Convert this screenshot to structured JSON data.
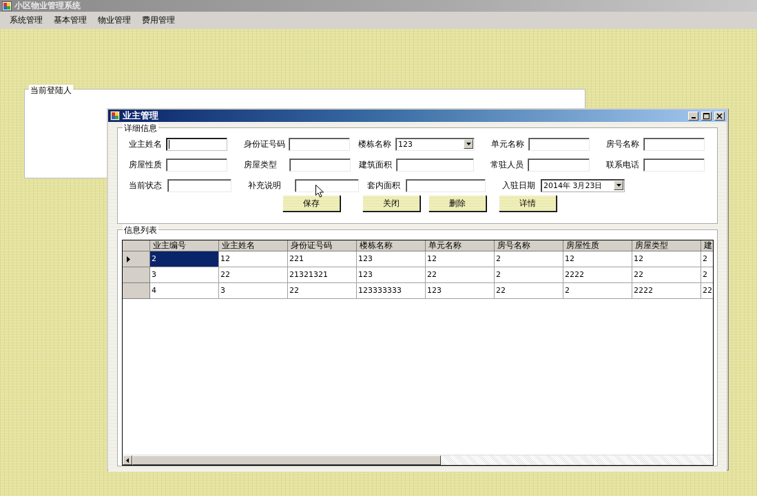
{
  "window": {
    "title": "小区物业管理系统"
  },
  "menu": [
    "系统管理",
    "基本管理",
    "物业管理",
    "费用管理"
  ],
  "login_group": {
    "title": "当前登陆人"
  },
  "child_window": {
    "title": "业主管理"
  },
  "detail_group": {
    "title": "详细信息",
    "rows": [
      [
        {
          "label": "业主姓名",
          "kind": "text",
          "focused": true
        },
        {
          "label": "身份证号码",
          "kind": "text",
          "focused": false
        },
        {
          "label": "楼栋名称",
          "kind": "combo",
          "value": "123",
          "focused": false
        },
        {
          "label": "单元名称",
          "kind": "text",
          "focused": false
        },
        {
          "label": "房号名称",
          "kind": "text",
          "focused": false
        }
      ],
      [
        {
          "label": "房屋性质",
          "kind": "text",
          "focused": false
        },
        {
          "label": "房屋类型",
          "kind": "text",
          "focused": false
        },
        {
          "label": "建筑面积",
          "kind": "text",
          "focused": false
        },
        {
          "label": "常驻人员",
          "kind": "text",
          "focused": false
        },
        {
          "label": "联系电话",
          "kind": "text",
          "focused": false
        }
      ],
      [
        {
          "label": "当前状态",
          "kind": "text",
          "focused": false
        },
        {
          "label": "补充说明",
          "kind": "text",
          "focused": false
        },
        {
          "label": "套内面积",
          "kind": "text",
          "focused": false
        },
        {
          "label": "入驻日期",
          "kind": "date",
          "value": "2014年  3月23日",
          "focused": false
        }
      ]
    ],
    "buttons": [
      "保存",
      "关闭",
      "删除",
      "详情"
    ]
  },
  "list_group": {
    "title": "信息列表",
    "columns": [
      "业主编号",
      "业主姓名",
      "身份证号码",
      "楼栋名称",
      "单元名称",
      "房号名称",
      "房屋性质",
      "房屋类型",
      "建"
    ],
    "rows": [
      {
        "selected": true,
        "cells": [
          "2",
          "12",
          "221",
          "123",
          "12",
          "2",
          "12",
          "12",
          "2"
        ]
      },
      {
        "selected": false,
        "cells": [
          "3",
          "22",
          "21321321",
          "123",
          "22",
          "2",
          "2222",
          "22",
          "2"
        ]
      },
      {
        "selected": false,
        "cells": [
          "4",
          "3",
          "22",
          "123333333",
          "123",
          "22",
          "2",
          "2222",
          "22"
        ]
      }
    ]
  }
}
